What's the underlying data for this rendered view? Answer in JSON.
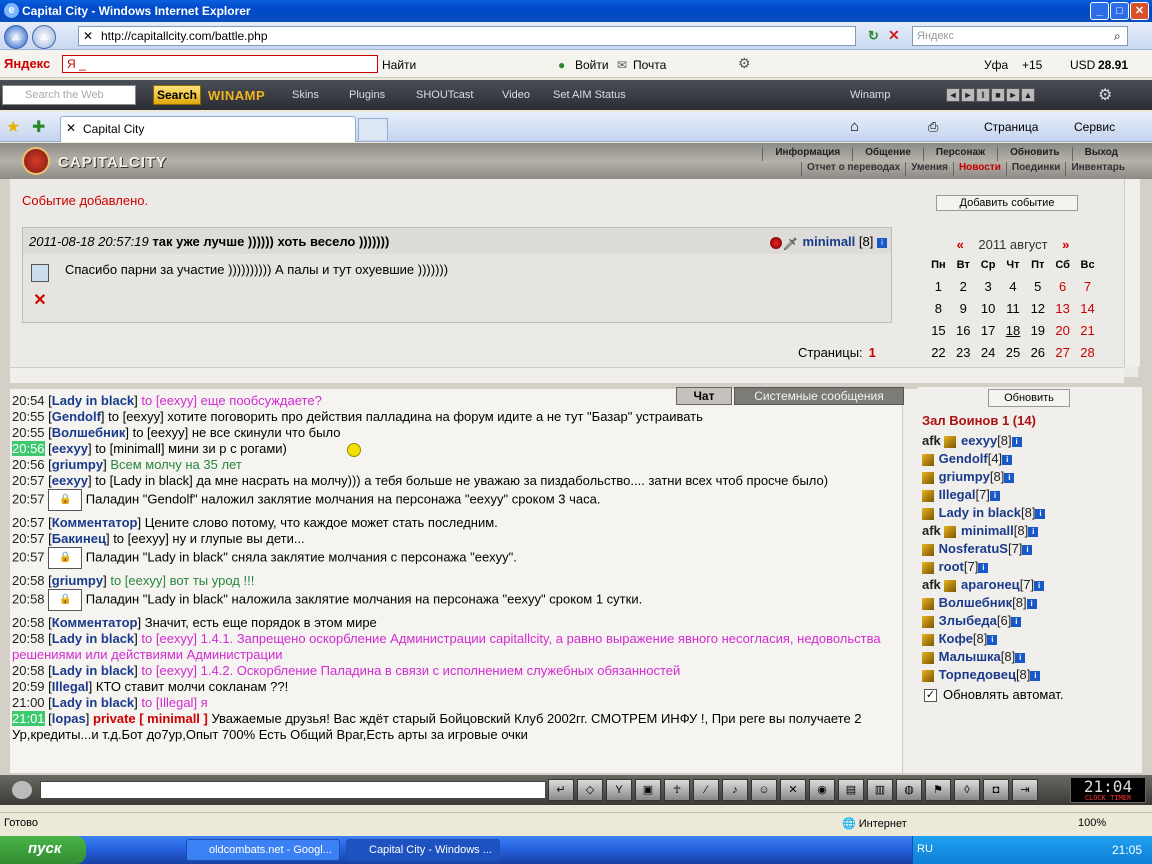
{
  "window": {
    "title": "Capital City - Windows Internet Explorer"
  },
  "address": {
    "url": "http://capitallcity.com/battle.php",
    "search_placeholder": "Яндекс"
  },
  "yandex_bar": {
    "brand": "Яндекс",
    "input": "Я _",
    "find": "Найти",
    "login": "Войти",
    "mail": "Почта",
    "city": "Уфа",
    "temp": "+15",
    "currency": "USD",
    "rate": "28.91"
  },
  "winamp_bar": {
    "search_placeholder": "Search the Web",
    "search_btn": "Search",
    "logo": "WINAMP",
    "menu": [
      "Skins",
      "Plugins",
      "SHOUTcast",
      "Video",
      "Set AIM Status"
    ],
    "player": "Winamp"
  },
  "tabs": {
    "active": "Capital City",
    "page": "Страница",
    "service": "Сервис"
  },
  "game": {
    "title": "CAPITALCITY",
    "menu_top": [
      "Информация",
      "Общение",
      "Персонаж",
      "Обновить",
      "Выход"
    ],
    "menu_sub": [
      "Отчет о переводах",
      "Умения",
      "Новости",
      "Поединки",
      "Инвентарь"
    ],
    "active_sub": "Новости",
    "event_added": "Событие добавлено.",
    "add_event_btn": "Добавить событие",
    "event": {
      "date": "2011-08-18 20:57:19",
      "title": "так уже лучше )))))) хоть весело )))))))",
      "author": "minimall",
      "level": "[8]",
      "body": "Спасибо парни за участие )))))))))) А палы и тут охуевшие )))))))"
    },
    "pages_label": "Страницы:",
    "pages_value": "1",
    "calendar": {
      "prev": "«",
      "next": "»",
      "month": "2011 август",
      "days": [
        "Пн",
        "Вт",
        "Ср",
        "Чт",
        "Пт",
        "Сб",
        "Вс"
      ],
      "rows": [
        [
          "1",
          "2",
          "3",
          "4",
          "5",
          "6",
          "7"
        ],
        [
          "8",
          "9",
          "10",
          "11",
          "12",
          "13",
          "14"
        ],
        [
          "15",
          "16",
          "17",
          "18",
          "19",
          "20",
          "21"
        ],
        [
          "22",
          "23",
          "24",
          "25",
          "26",
          "27",
          "28"
        ]
      ]
    },
    "chat_tab": "Чат",
    "system_tab": "Системные сообщения",
    "refresh_btn": "Обновить",
    "room": "Зал Воинов 1 (14)",
    "users": [
      {
        "afk": "afk",
        "name": "eexyy",
        "lvl": "[8]"
      },
      {
        "afk": "",
        "name": "Gendolf",
        "lvl": "[4]"
      },
      {
        "afk": "",
        "name": "griumpy",
        "lvl": "[8]"
      },
      {
        "afk": "",
        "name": "Illegal",
        "lvl": "[7]"
      },
      {
        "afk": "",
        "name": "Lady in black",
        "lvl": "[8]"
      },
      {
        "afk": "afk",
        "name": "minimall",
        "lvl": "[8]"
      },
      {
        "afk": "",
        "name": "NosferatuS",
        "lvl": "[7]"
      },
      {
        "afk": "",
        "name": "root",
        "lvl": "[7]"
      },
      {
        "afk": "afk",
        "name": "арагонец",
        "lvl": "[7]"
      },
      {
        "afk": "",
        "name": "Волшебник",
        "lvl": "[8]"
      },
      {
        "afk": "",
        "name": "Злыбеда",
        "lvl": "[6]"
      },
      {
        "afk": "",
        "name": "Кофе",
        "lvl": "[8]"
      },
      {
        "afk": "",
        "name": "Малышка",
        "lvl": "[8]"
      },
      {
        "afk": "",
        "name": "Торпедовец",
        "lvl": "[8]"
      }
    ],
    "auto_refresh": "Обновлять автомат.",
    "clock": "21:04",
    "clock_sub": "CLOCK TIMER",
    "chat": [
      {
        "t": "20:54",
        "nick": "Lady in black",
        "text": "to [eexyy] еще пообсуждаете?",
        "cls": "pink"
      },
      {
        "t": "20:55",
        "nick": "Gendolf",
        "text": "to [eexyy] хотите поговорить про действия палладина на форум идите а не тут \"Базар\" устраивать",
        "cls": ""
      },
      {
        "t": "20:55",
        "nick": "Волшебник",
        "text": "to [eexyy] не все скинули что было",
        "cls": ""
      },
      {
        "t": "20:56",
        "nick": "eexyy",
        "text": "to [minimall] мини зи р с рогами)",
        "cls": "",
        "hl": true
      },
      {
        "t": "20:56",
        "nick": "griumpy",
        "text": "Всем молчу на 35 лет",
        "cls": "green"
      },
      {
        "t": "20:57",
        "nick": "eexyy",
        "text": "to [Lady in black] да мне насрать на молчу))) а тебя больше не уважаю за пиздабольство.... затни всех чтоб просче было)",
        "cls": ""
      },
      {
        "t": "20:57",
        "sys": "Паладин \"Gendolf\" наложил заклятие молчания на персонажа \"eexyy\" сроком 3 часа."
      },
      {
        "t": "20:57",
        "nick": "Комментатор",
        "text": "Цените слово потому, что каждое может стать последним.",
        "cls": ""
      },
      {
        "t": "20:57",
        "nick": "Бакинец",
        "text": "to [eexyy] ну и глупые вы дети...",
        "cls": ""
      },
      {
        "t": "20:57",
        "sys": "Паладин \"Lady in black\" сняла заклятие молчания с персонажа \"eexyy\"."
      },
      {
        "t": "20:58",
        "nick": "griumpy",
        "text": "to [eexyy] вот ты урод !!!",
        "cls": "green"
      },
      {
        "t": "20:58",
        "sys": "Паладин \"Lady in black\" наложила заклятие молчания на персонажа \"eexyy\" сроком 1 сутки."
      },
      {
        "t": "20:58",
        "nick": "Комментатор",
        "text": "Значит, есть еще порядок в этом мире",
        "cls": ""
      },
      {
        "t": "20:58",
        "nick": "Lady in black",
        "text": "to [eexyy] 1.4.1. Запрещено оскорбление Администрации capitallcity, а равно выражение явного несогласия, недовольства решениями или действиями Администрации",
        "cls": "pink"
      },
      {
        "t": "20:58",
        "nick": "Lady in black",
        "text": "to [eexyy] 1.4.2. Оскорбление Паладина в связи с исполнением служебных обязанностей",
        "cls": "pink"
      },
      {
        "t": "20:59",
        "nick": "Illegal",
        "text": "КТО ставит молчи сокланам ??!",
        "cls": ""
      },
      {
        "t": "21:00",
        "nick": "Lady in black",
        "text": "to [Illegal] я",
        "cls": "pink"
      },
      {
        "t": "21:01",
        "nick": "lopas",
        "priv": "private [ minimall ]",
        "text": "Уважаемые друзья! Вас ждёт старый Бойцовский Клуб 2002гг. СМОТРЕМ ИНФУ !, При реге вы получаете 2 Ур,кредиты...и т.д.Бот до7ур,Опыт 700% Есть Общий Враг,Есть арты за игровые очки",
        "cls": "",
        "hl": true
      }
    ]
  },
  "status": {
    "text": "Готово",
    "zone": "Интернет",
    "zoom": "100%"
  },
  "taskbar": {
    "start": "пуск",
    "tasks": [
      "oldcombats.net - Googl...",
      "Capital City - Windows ..."
    ],
    "lang": "RU",
    "time": "21:05"
  }
}
